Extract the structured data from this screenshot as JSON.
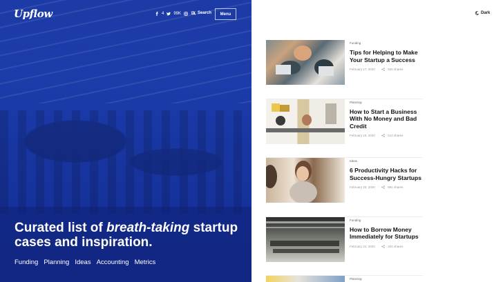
{
  "brand": {
    "logo": "Upflow"
  },
  "header": {
    "social": [
      {
        "icon": "facebook-icon",
        "count": "4"
      },
      {
        "icon": "twitter-icon",
        "count": "99K"
      },
      {
        "icon": "instagram-icon",
        "count": "1K"
      }
    ],
    "search_label": "Search",
    "menu_label": "Menu",
    "dark_label": "Dark"
  },
  "hero": {
    "headline_pre": "Curated list of",
    "headline_em": "breath-taking",
    "headline_post": "startup cases and inspiration.",
    "categories": [
      "Funding",
      "Planning",
      "Ideas",
      "Accounting",
      "Metrics"
    ]
  },
  "posts": [
    {
      "category": "Funding",
      "title": "Tips for Helping to Make Your Startup a Success",
      "date": "February 17, 2020",
      "shares": "925 shares"
    },
    {
      "category": "Planning",
      "title": "How to Start a Business With No Money and Bad Credit",
      "date": "February 16, 2020",
      "shares": "512 shares"
    },
    {
      "category": "Ideas",
      "title": "6 Productivity Hacks for Success-Hungry Startups",
      "date": "February 20, 2020",
      "shares": "881 shares"
    },
    {
      "category": "Funding",
      "title": "How to Borrow Money Immediately for Startups",
      "date": "February 24, 2020",
      "shares": "404 shares"
    },
    {
      "category": "Planning"
    }
  ],
  "colors": {
    "hero_overlay": "#2a4fd0",
    "text_dark": "#111111"
  }
}
